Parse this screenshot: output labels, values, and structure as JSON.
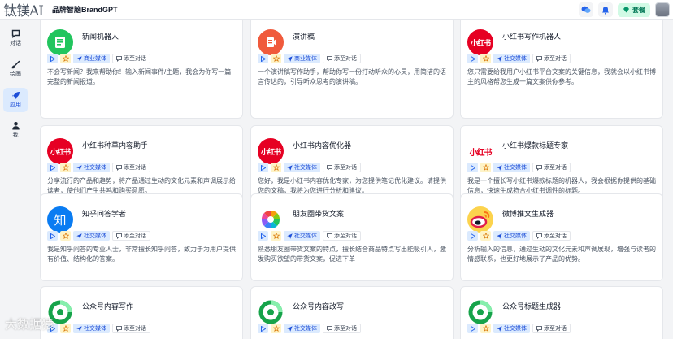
{
  "app": {
    "logo_text": "钛镁AI",
    "brand_title": "品牌智脑BrandGPT",
    "package_label": "套餐"
  },
  "sidebar": {
    "items": [
      {
        "label": "对话",
        "icon": "chat-icon"
      },
      {
        "label": "绘画",
        "icon": "brush-icon"
      },
      {
        "label": "应用",
        "icon": "rocket-icon",
        "active": true
      },
      {
        "label": "我",
        "icon": "user-icon"
      }
    ]
  },
  "card_actions": {
    "add_label": "添至对话"
  },
  "cards": [
    {
      "title": "新闻机器人",
      "tag": "商业媒体",
      "icon": "news-icon",
      "desc": "不会写新闻？我来帮助你！输入新闻事件/主题，我会为你写一篇完整的新闻报道。"
    },
    {
      "title": "演讲稿",
      "tag": "商业媒体",
      "icon": "speech-icon",
      "desc": "一个演讲稿写作助手，帮助你写一份打动听众的心灵，用简洁的语言传达的，引导听众思考的演讲稿。"
    },
    {
      "title": "小红书写作机器人",
      "tag": "社交媒体",
      "icon": "xiaohongshu-icon",
      "desc": "您只需要给我用户小红书平台文案的关键信息，我就会以小红书博主的风格帮您生成一篇文案供你参考。"
    },
    {
      "title": "小红书种草内容助手",
      "tag": "社交媒体",
      "icon": "xiaohongshu-icon",
      "desc": "分享流行的产品和趋势，将产品通过生动的文化元素和声调展示给读者，使他们产生共鸣和购买意愿。"
    },
    {
      "title": "小红书内容优化器",
      "tag": "社交媒体",
      "icon": "xiaohongshu-icon",
      "desc": "您好，我是小红书内容优化专家，为您提供笔记优化建议。请提供您的文稿，我将为您进行分析和建议。"
    },
    {
      "title": "小红书爆款标题专家",
      "tag": "社交媒体",
      "icon": "xiaohongshu-icon",
      "desc": "我是一个擅长写小红书爆款标题的机器人，我会根据你提供的基础信息，快速生成符合小红书调性的标题。"
    },
    {
      "title": "知乎问答学者",
      "tag": "社交媒体",
      "icon": "zhihu-icon",
      "desc": "我是知乎问答的专业人士，非常擅长知乎问答，致力于为用户提供有价值、结构化的答案。"
    },
    {
      "title": "朋友圈带货文案",
      "tag": "社交媒体",
      "icon": "moments-icon",
      "desc": "熟悉朋友圈带货文案的特点，擅长结合商品特点写出能吸引人，激发购买欲望的带货文案，促进下单"
    },
    {
      "title": "微博推文生成器",
      "tag": "社交媒体",
      "icon": "weibo-icon",
      "desc": "分析输入的信息，通过生动的文化元素和声调展现，增强与读者的情感联系，也更好地展示了产品的优势。"
    },
    {
      "title": "公众号内容写作",
      "tag": "社交媒体",
      "icon": "wechat-official-icon",
      "desc": ""
    },
    {
      "title": "公众号内容改写",
      "tag": "社交媒体",
      "icon": "wechat-official-icon",
      "desc": ""
    },
    {
      "title": "公众号标题生成器",
      "tag": "社交媒体",
      "icon": "wechat-official-icon",
      "desc": ""
    }
  ],
  "watermark_text": "大数据猿",
  "colors": {
    "accent_blue": "#1d4ed8",
    "tag_bg": "#dbeafe",
    "package_green": "#047857",
    "xiaohongshu_red": "#e60023"
  }
}
